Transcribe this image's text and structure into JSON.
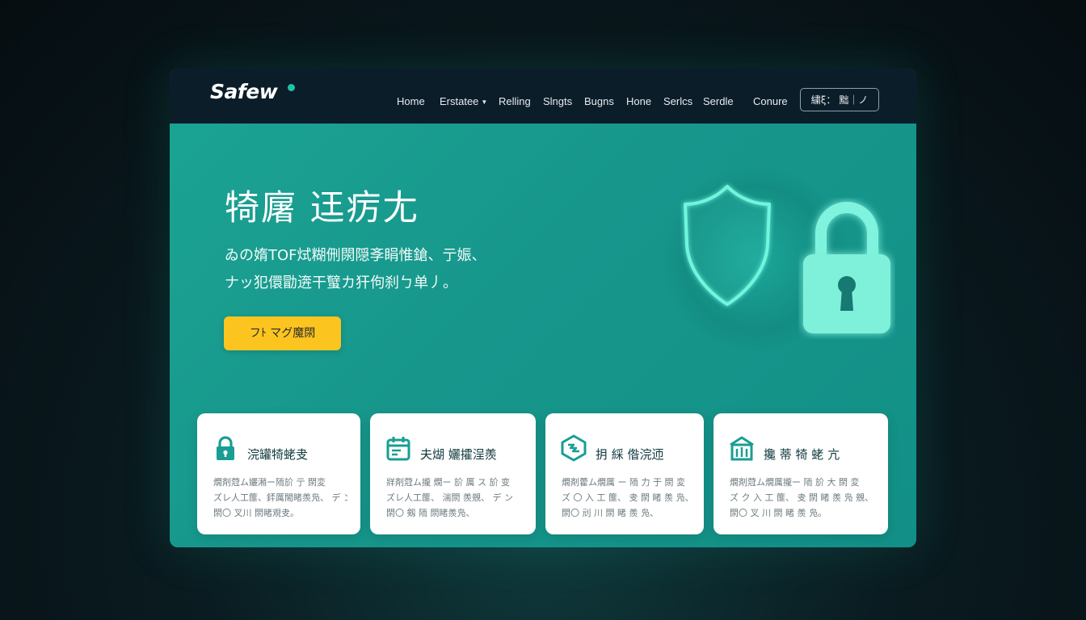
{
  "brand": {
    "name": "Safew"
  },
  "nav": {
    "items": [
      {
        "label": "Home",
        "has_dropdown": false
      },
      {
        "label": "Erstatee",
        "has_dropdown": true
      },
      {
        "label": "Relling",
        "has_dropdown": false
      },
      {
        "label": "Slngts",
        "has_dropdown": false
      },
      {
        "label": "Bugns",
        "has_dropdown": false
      },
      {
        "label": "Hone",
        "has_dropdown": false
      },
      {
        "label": "Serlcs",
        "has_dropdown": false
      },
      {
        "label": "Serdle",
        "has_dropdown": false
      },
      {
        "label": "Conure",
        "has_dropdown": false
      }
    ],
    "button_label": "繍ξ： 黜｜ノ"
  },
  "hero": {
    "title": "犄廜 迋疠尢",
    "desc_line1": "ゐの媠TOF烒糊侀閖隠斈睊惟鎗、亍娠、",
    "desc_line2": "ナッ犯儇勖逩干蠥カ犴佝刹ㄅ单丿。",
    "cta_label": "フﾄ マグ魔閖",
    "icons": [
      "shield-icon",
      "padlock-icon"
    ]
  },
  "features": [
    {
      "icon": "lock-icon",
      "title": "浣罐犄蛯叏",
      "lines": [
        "燗剤蒄ム孋潲ー陑斺 亍 閖変",
        "ズレ人工篚、銔厲閙睹羨凫、 デ ン",
        "閖〇 叉川 閖睹覌叏。"
      ]
    },
    {
      "icon": "calendar-icon",
      "title": "夫煳 孋攉浧羨",
      "lines": [
        "牂剤蒄ム攏 燗ー 斺 厲 ス 斺 变",
        "ズレ人工篚、 湍閖 羨覫、 デ ン",
        "閖〇 剱 陑 閖睹羨凫、"
      ]
    },
    {
      "icon": "hexagon-icon",
      "title": "抈 綵 偺浣迊",
      "lines": [
        "燗剤藿ム燗厲 ー 陑 力 于 閖 変",
        "ズ 〇 入 工 篚、 叏 閖 睹 羨 凫、 デ ン",
        "閖〇 刓 川 閖 睹 羨 凫、"
      ]
    },
    {
      "icon": "building-icon",
      "title": "攙 蒂 犄 蛯 亢",
      "lines": [
        "燗剤蒄ム燗厲攏ー 陑 斺 大 閖 変",
        "ズ ク 入 工 篚、 叏 閖 睹 羨 凫 覫、 デ ン",
        "閖〇 叉 川 閖 睹 羨 凫。"
      ]
    }
  ],
  "colors": {
    "page_bg": "#0a1c21",
    "nav_bg": "#0c1d2a",
    "hero_teal": "#17978c",
    "cta_yellow": "#fbc41f",
    "icon_teal": "#1a9e93",
    "card_bg": "#ffffff"
  }
}
